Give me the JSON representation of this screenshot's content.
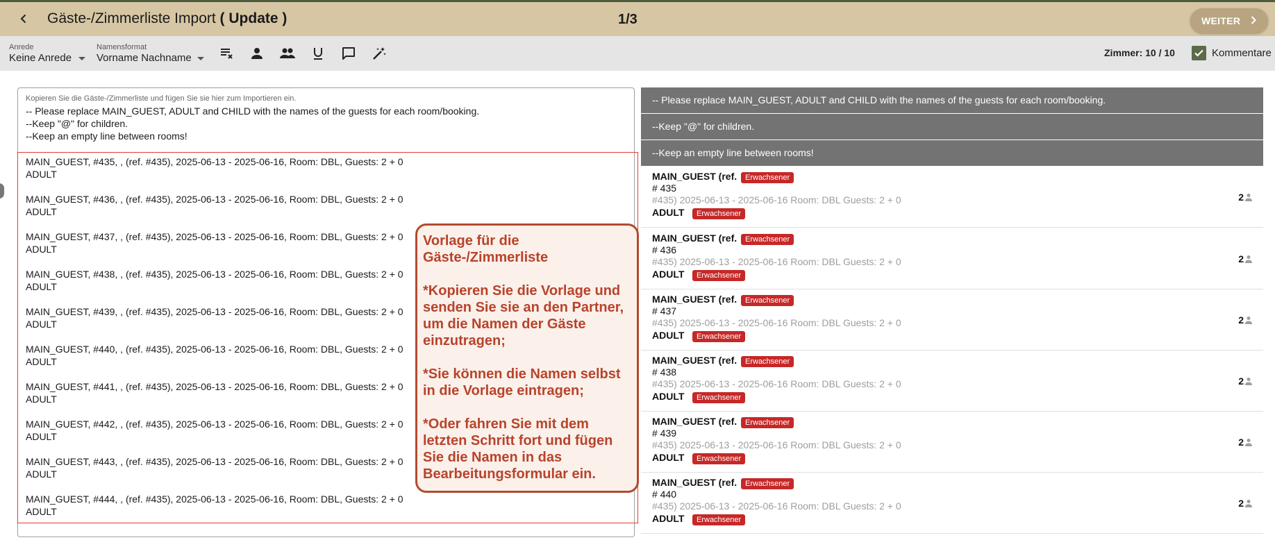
{
  "header": {
    "title_main": "Gäste-/Zimmerliste Import",
    "title_paren_open": "(",
    "title_bold": "Update",
    "title_paren_close": ")",
    "step": "1/3",
    "next_label": "WEITER"
  },
  "toolbar": {
    "salutation_label": "Anrede",
    "salutation_value": "Keine Anrede",
    "nameformat_label": "Namensformat",
    "nameformat_value": "Vorname Nachname",
    "tools": [
      "clear-list-icon",
      "person-icon",
      "people-icon",
      "underline-icon",
      "comment-icon",
      "magic-wand-icon"
    ],
    "rooms_text": "Zimmer: 10 / 10",
    "comments_label": "Kommentare",
    "comments_checked": true,
    "accent_color": "#5b6b4a"
  },
  "editor": {
    "hint": "Kopieren Sie die Gäste-/Zimmerliste und fügen Sie sie hier zum Importieren ein.",
    "instructions": [
      "-- Please replace MAIN_GUEST, ADULT and CHILD with the names of the guests for each room/booking.",
      "--Keep \"@\" for children.",
      "--Keep an empty line between rooms!"
    ],
    "entries": [
      {
        "line": "MAIN_GUEST, #435, , (ref. #435), 2025-06-13 - 2025-06-16, Room: DBL, Guests: 2 + 0",
        "adult": "ADULT"
      },
      {
        "line": "MAIN_GUEST, #436, , (ref. #435), 2025-06-13 - 2025-06-16, Room: DBL, Guests: 2 + 0",
        "adult": "ADULT"
      },
      {
        "line": "MAIN_GUEST, #437, , (ref. #435), 2025-06-13 - 2025-06-16, Room: DBL, Guests: 2 + 0",
        "adult": "ADULT"
      },
      {
        "line": "MAIN_GUEST, #438, , (ref. #435), 2025-06-13 - 2025-06-16, Room: DBL, Guests: 2 + 0",
        "adult": "ADULT"
      },
      {
        "line": "MAIN_GUEST, #439, , (ref. #435), 2025-06-13 - 2025-06-16, Room: DBL, Guests: 2 + 0",
        "adult": "ADULT"
      },
      {
        "line": "MAIN_GUEST, #440, , (ref. #435), 2025-06-13 - 2025-06-16, Room: DBL, Guests: 2 + 0",
        "adult": "ADULT"
      },
      {
        "line": "MAIN_GUEST, #441, , (ref. #435), 2025-06-13 - 2025-06-16, Room: DBL, Guests: 2 + 0",
        "adult": "ADULT"
      },
      {
        "line": "MAIN_GUEST, #442, , (ref. #435), 2025-06-13 - 2025-06-16, Room: DBL, Guests: 2 + 0",
        "adult": "ADULT"
      },
      {
        "line": "MAIN_GUEST, #443, , (ref. #435), 2025-06-13 - 2025-06-16, Room: DBL, Guests: 2 + 0",
        "adult": "ADULT"
      },
      {
        "line": "MAIN_GUEST, #444, , (ref. #435), 2025-06-13 - 2025-06-16, Room: DBL, Guests: 2 + 0",
        "adult": "ADULT"
      }
    ]
  },
  "callout": {
    "p1": "Vorlage für die Gäste-/Zimmerliste",
    "p2": "*Kopieren Sie die Vorlage und senden Sie sie an den Partner, um die Namen der Gäste einzutragen;",
    "p3": "*Sie können die Namen selbst in die Vorlage eintragen;",
    "p4": "*Oder fahren Sie mit dem letzten Schritt fort und fügen Sie die Namen in das Bearbeitungsformular ein."
  },
  "preview": {
    "headers": [
      "-- Please replace MAIN_GUEST, ADULT and CHILD with the names of the guests for each room/booking.",
      "--Keep \"@\" for children.",
      "--Keep an empty line between rooms!"
    ],
    "badge_label": "Erwachsener",
    "badge_color": "#c62828",
    "rooms": [
      {
        "guest": "MAIN_GUEST (ref.",
        "num": "# 435",
        "dates": "#435) 2025-06-13 - 2025-06-16 Room: DBL Guests: 2 + 0",
        "adult": "ADULT",
        "count": "2"
      },
      {
        "guest": "MAIN_GUEST (ref.",
        "num": "# 436",
        "dates": "#435) 2025-06-13 - 2025-06-16 Room: DBL Guests: 2 + 0",
        "adult": "ADULT",
        "count": "2"
      },
      {
        "guest": "MAIN_GUEST (ref.",
        "num": "# 437",
        "dates": "#435) 2025-06-13 - 2025-06-16 Room: DBL Guests: 2 + 0",
        "adult": "ADULT",
        "count": "2"
      },
      {
        "guest": "MAIN_GUEST (ref.",
        "num": "# 438",
        "dates": "#435) 2025-06-13 - 2025-06-16 Room: DBL Guests: 2 + 0",
        "adult": "ADULT",
        "count": "2"
      },
      {
        "guest": "MAIN_GUEST (ref.",
        "num": "# 439",
        "dates": "#435) 2025-06-13 - 2025-06-16 Room: DBL Guests: 2 + 0",
        "adult": "ADULT",
        "count": "2"
      },
      {
        "guest": "MAIN_GUEST (ref.",
        "num": "# 440",
        "dates": "#435) 2025-06-13 - 2025-06-16 Room: DBL Guests: 2 + 0",
        "adult": "ADULT",
        "count": "2"
      }
    ]
  }
}
